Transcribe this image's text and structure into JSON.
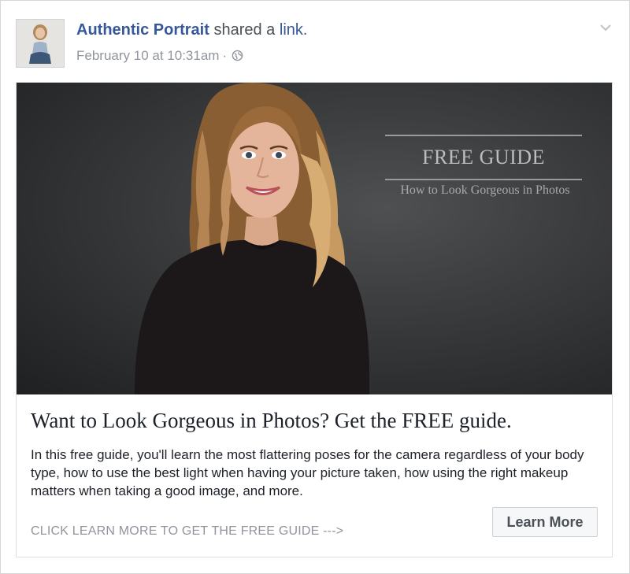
{
  "post": {
    "author": "Authentic Portrait",
    "action_prefix": "shared a",
    "action_link": "link.",
    "timestamp": "February 10 at 10:31am",
    "separator": "·",
    "privacy_icon": "globe-icon",
    "menu_icon": "chevron-down-icon"
  },
  "link_card": {
    "image": {
      "guide_title": "FREE GUIDE",
      "guide_subtitle": "How to Look Gorgeous in Photos"
    },
    "title": "Want to Look Gorgeous in Photos? Get the FREE guide.",
    "description": "In this free guide, you'll learn the most flattering poses for the camera regardless of your body type, how to use the best light when having your picture taken, how using the right makeup matters when taking a good image, and more.",
    "caption": "CLICK LEARN MORE TO GET THE FREE GUIDE --->",
    "cta_label": "Learn More"
  },
  "colors": {
    "author_link": "#365899",
    "meta_text": "#90949c",
    "body_text": "#1d2129",
    "hero_background": "#2f3032"
  }
}
